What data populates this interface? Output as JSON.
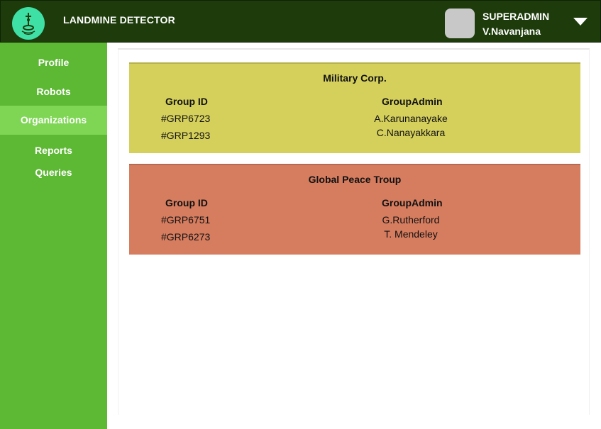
{
  "header": {
    "app_title": "LANDMINE DETECTOR",
    "logo_icon": "landmine-detector-icon",
    "user_role": "SUPERADMIN",
    "user_name": "V.Navanjana",
    "dropdown_icon": "caret-down-icon"
  },
  "colors": {
    "header_bg": "#1d3b0b",
    "sidebar_bg": "#5db834",
    "sidebar_active_bg": "#7fd655",
    "logo_bg": "#3ee0a6",
    "card_military_bg": "#d5d05c",
    "card_peace_bg": "#d67d60"
  },
  "sidebar": {
    "items": [
      {
        "label": "Profile",
        "active": false
      },
      {
        "label": "Robots",
        "active": false
      },
      {
        "label": "Organizations",
        "active": true
      },
      {
        "label": "Reports",
        "active": false
      },
      {
        "label": "Queries",
        "active": false
      }
    ]
  },
  "organizations": [
    {
      "name": "Military Corp.",
      "col_group_id": "Group ID",
      "col_group_admin": "GroupAdmin",
      "rows": [
        {
          "group_id": "#GRP6723",
          "group_admin": "A.Karunanayake"
        },
        {
          "group_id": "#GRP1293",
          "group_admin": "C.Nanayakkara"
        }
      ]
    },
    {
      "name": "Global Peace Troup",
      "col_group_id": "Group ID",
      "col_group_admin": "GroupAdmin",
      "rows": [
        {
          "group_id": "#GRP6751",
          "group_admin": "G.Rutherford"
        },
        {
          "group_id": "#GRP6273",
          "group_admin": "T. Mendeley"
        }
      ]
    }
  ]
}
